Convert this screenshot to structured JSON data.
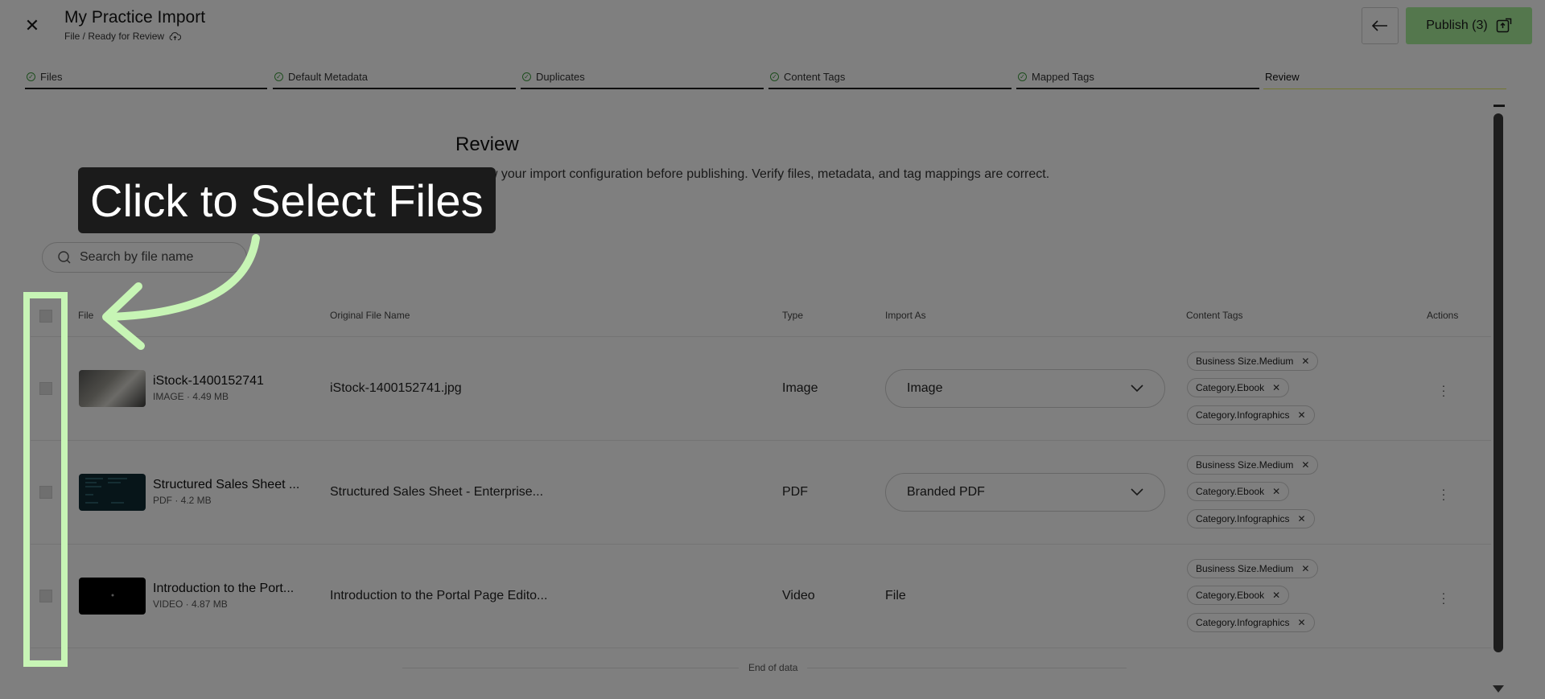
{
  "header": {
    "title": "My Practice Import",
    "breadcrumb": "File / Ready for Review",
    "publish_label": "Publish (3)"
  },
  "steps": [
    {
      "label": "Files",
      "done": true
    },
    {
      "label": "Default Metadata",
      "done": true
    },
    {
      "label": "Duplicates",
      "done": true
    },
    {
      "label": "Content Tags",
      "done": true
    },
    {
      "label": "Mapped Tags",
      "done": true
    },
    {
      "label": "Review",
      "done": false,
      "active": true
    }
  ],
  "review": {
    "heading": "Review",
    "description": "Review your import configuration before publishing. Verify files, metadata, and tag mappings are correct."
  },
  "search": {
    "placeholder": "Search by file name"
  },
  "table": {
    "columns": [
      "File",
      "Original File Name",
      "Type",
      "Import As",
      "Content Tags",
      "Actions"
    ],
    "rows": [
      {
        "name": "iStock-1400152741",
        "meta": "IMAGE · 4.49 MB",
        "original": "iStock-1400152741.jpg",
        "type": "Image",
        "import_as": "Image",
        "tags": [
          "Business Size.Medium",
          "Category.Ebook",
          "Category.Infographics"
        ]
      },
      {
        "name": "Structured Sales Sheet ...",
        "meta": "PDF · 4.2 MB",
        "original": "Structured Sales Sheet - Enterprise...",
        "type": "PDF",
        "import_as": "Branded PDF",
        "tags": [
          "Business Size.Medium",
          "Category.Ebook",
          "Category.Infographics"
        ]
      },
      {
        "name": "Introduction to the Port...",
        "meta": "VIDEO · 4.87 MB",
        "original": "Introduction to the Portal Page Edito...",
        "type": "Video",
        "import_as": "File",
        "tags": [
          "Business Size.Medium",
          "Category.Ebook",
          "Category.Infographics"
        ]
      }
    ],
    "end_text": "End of data"
  },
  "overlay": {
    "callout": "Click to Select Files",
    "highlight_color": "#c7f5b5"
  },
  "colors": {
    "publish_bg": "#a9ef9b",
    "step_check": "#3c9a3c",
    "active_underline": "#e6ee60"
  }
}
